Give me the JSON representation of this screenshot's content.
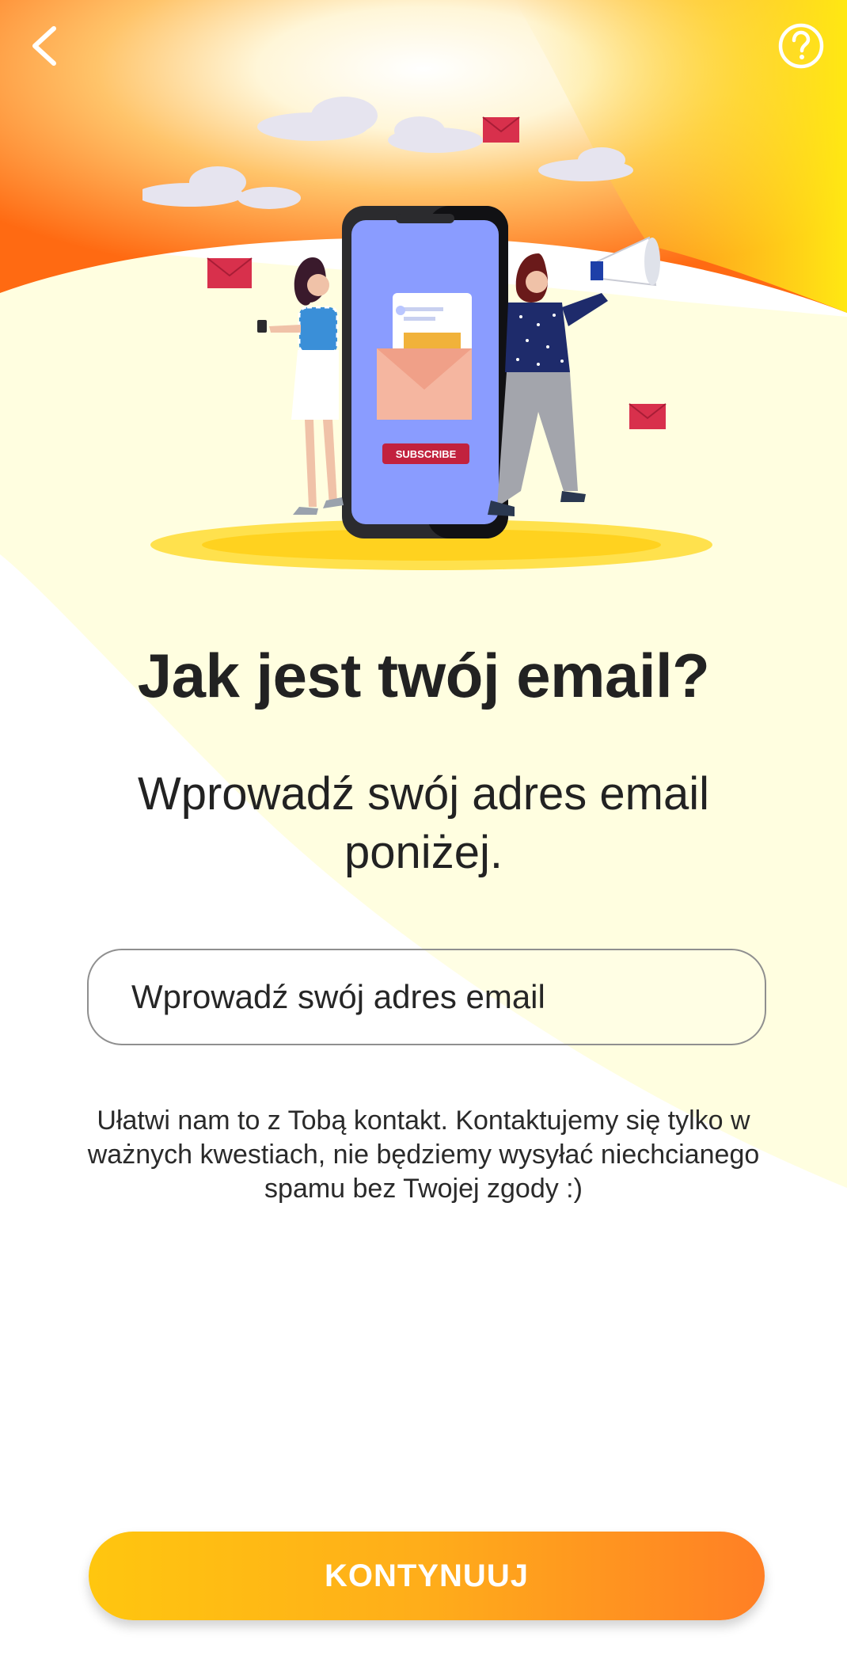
{
  "header": {
    "back_icon": "chevron-left-icon",
    "help_icon": "question-circle-icon"
  },
  "illustration": {
    "subscribe_label": "SUBSCRIBE"
  },
  "content": {
    "title": "Jak jest twój email?",
    "subtitle": "Wprowadź swój adres email poniżej.",
    "email_placeholder": "Wprowadź swój adres email",
    "info": "Ułatwi nam to z Tobą kontakt. Kontaktujemy się tylko w ważnych kwestiach, nie będziemy wysyłać niechcianego spamu bez Twojej zgody :)"
  },
  "footer": {
    "continue_label": "KONTYNUUJ"
  },
  "colors": {
    "accent_orange": "#ff7f25",
    "accent_yellow": "#ffc60f",
    "text_dark": "#222222",
    "background_yellow_soft": "#fffde0"
  }
}
